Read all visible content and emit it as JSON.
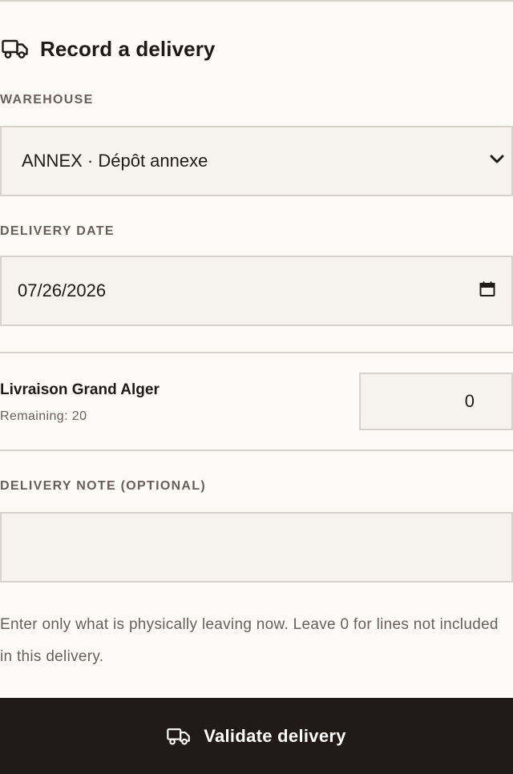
{
  "form": {
    "title": "Record a delivery",
    "warehouse": {
      "label": "WAREHOUSE",
      "selected": "ANNEX · Dépôt annexe"
    },
    "delivery_date": {
      "label": "DELIVERY DATE",
      "value": "07/26/2026"
    },
    "lines": [
      {
        "name": "Livraison Grand Alger",
        "remaining": "Remaining: 20",
        "quantity": "0"
      }
    ],
    "note": {
      "label": "DELIVERY NOTE (OPTIONAL)",
      "value": ""
    },
    "hint": "Enter only what is physically leaving now. Leave 0 for lines not included in this delivery.",
    "submit_label": "Validate delivery"
  },
  "icons": {
    "title_icon": "truck-icon",
    "select_icon": "chevron-down-icon",
    "date_icon": "calendar-icon",
    "submit_icon": "truck-icon"
  },
  "colors": {
    "background": "#fdfaf8",
    "field_background": "#f6f3ee",
    "border": "#d9d2cc",
    "text": "#1f1a18",
    "muted_text": "#6a5e5a",
    "button_background": "#221a18",
    "button_text": "#ffffff"
  }
}
